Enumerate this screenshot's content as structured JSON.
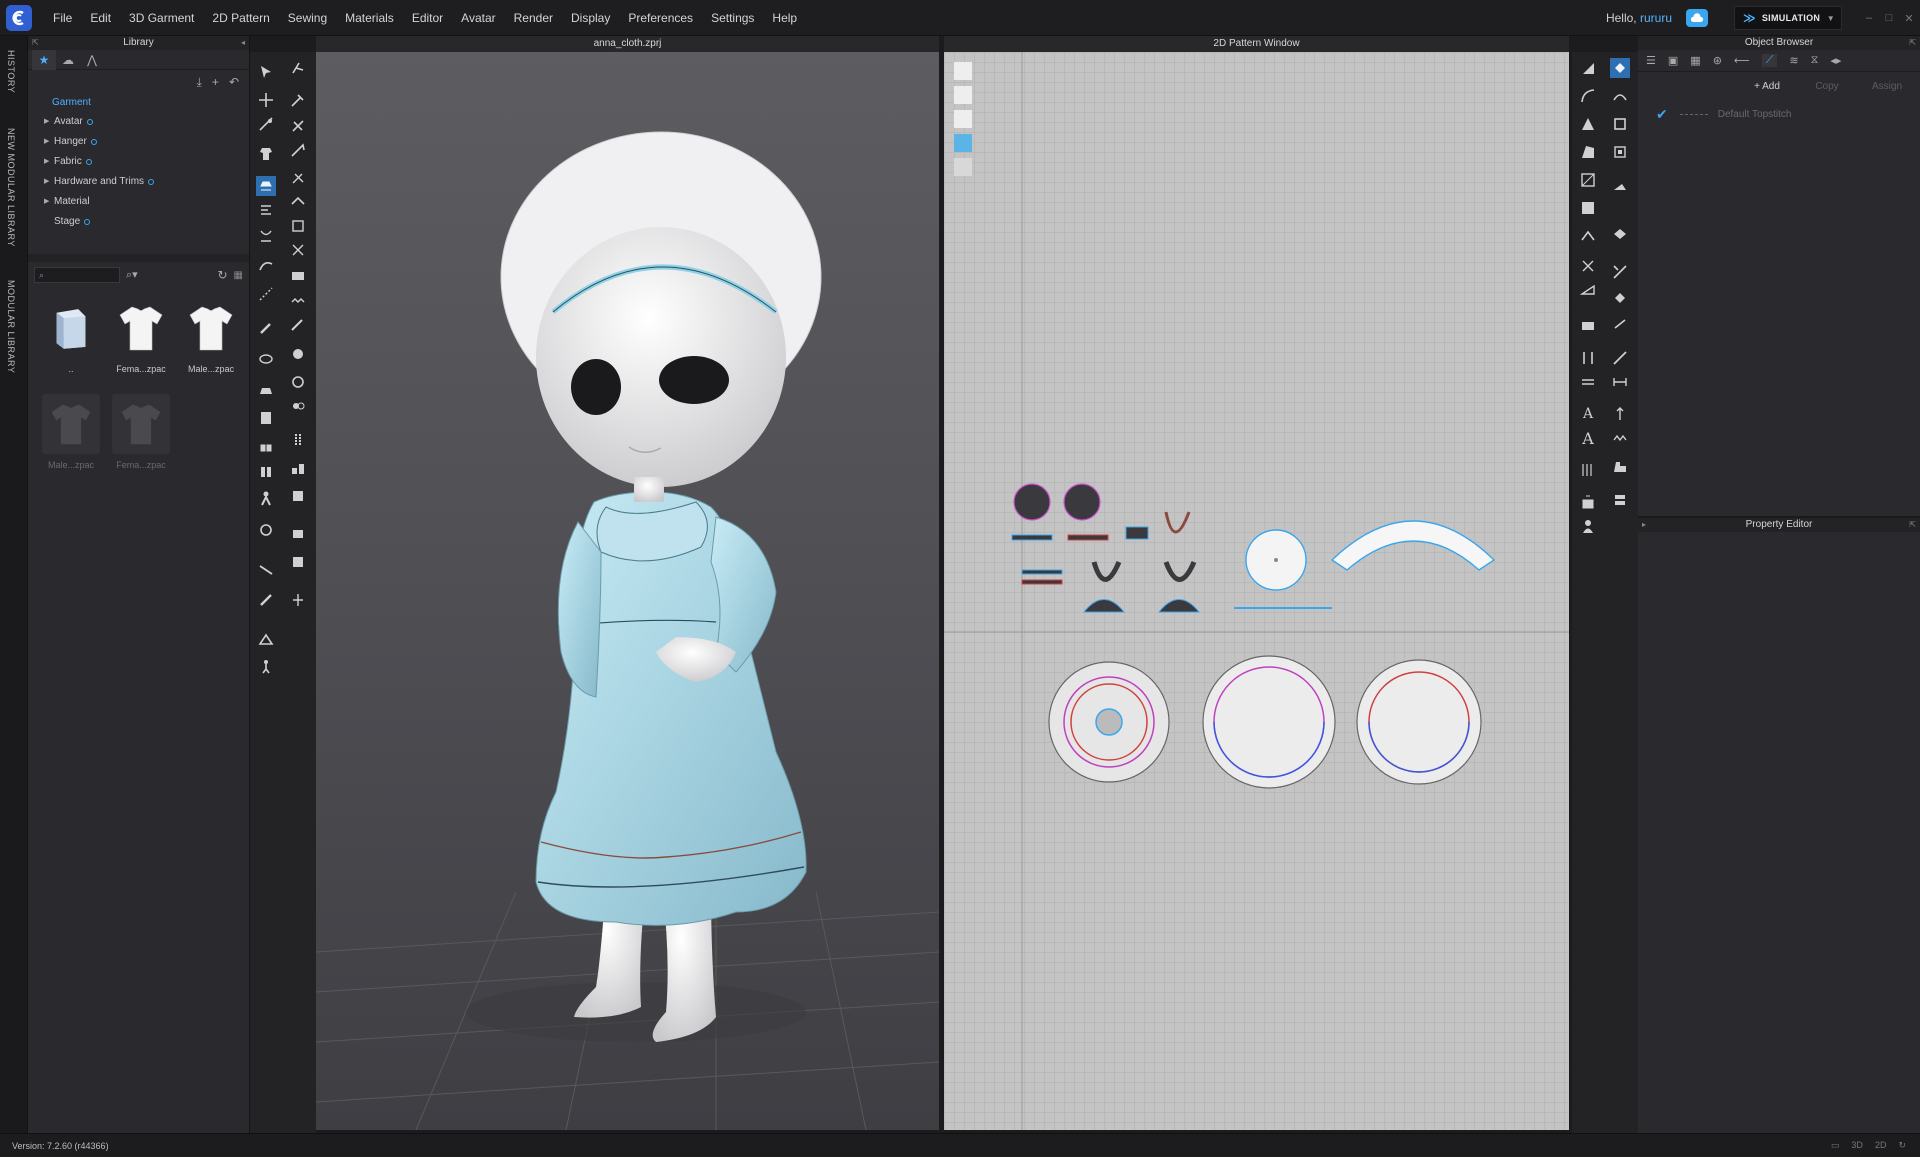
{
  "app": {
    "menu": [
      "File",
      "Edit",
      "3D Garment",
      "2D Pattern",
      "Sewing",
      "Materials",
      "Editor",
      "Avatar",
      "Render",
      "Display",
      "Preferences",
      "Settings",
      "Help"
    ],
    "greeting": "Hello,",
    "username": "rururu",
    "mode": "SIMULATION"
  },
  "side_tabs": [
    "HISTORY",
    "NEW MODULAR LIBRARY",
    "MODULAR LIBRARY"
  ],
  "library": {
    "title": "Library",
    "root": "Garment",
    "items": [
      "Avatar",
      "Hanger",
      "Fabric",
      "Hardware and Trims",
      "Material",
      "Stage"
    ],
    "files": [
      {
        "label": "..",
        "kind": "folder"
      },
      {
        "label": "Fema...zpac",
        "kind": "shirt-white"
      },
      {
        "label": "Male...zpac",
        "kind": "shirt-white"
      },
      {
        "label": "Male...zpac",
        "kind": "shirt-dark"
      },
      {
        "label": "Fema...zpac",
        "kind": "shirt-dark"
      }
    ]
  },
  "viewport3d": {
    "title": "anna_cloth.zprj"
  },
  "pattern2d": {
    "title": "2D Pattern Window"
  },
  "object_browser": {
    "title": "Object Browser",
    "add": "+ Add",
    "copy": "Copy",
    "assign": "Assign",
    "row": "Default Topstitch"
  },
  "property_editor": {
    "title": "Property Editor"
  },
  "status": {
    "version": "Version: 7.2.60 (r44366)",
    "modes": [
      "3D",
      "2D"
    ]
  },
  "colors": {
    "accent": "#3aa6ee",
    "dress": "#a9d7e6",
    "avatar": "#f0f0f0"
  }
}
